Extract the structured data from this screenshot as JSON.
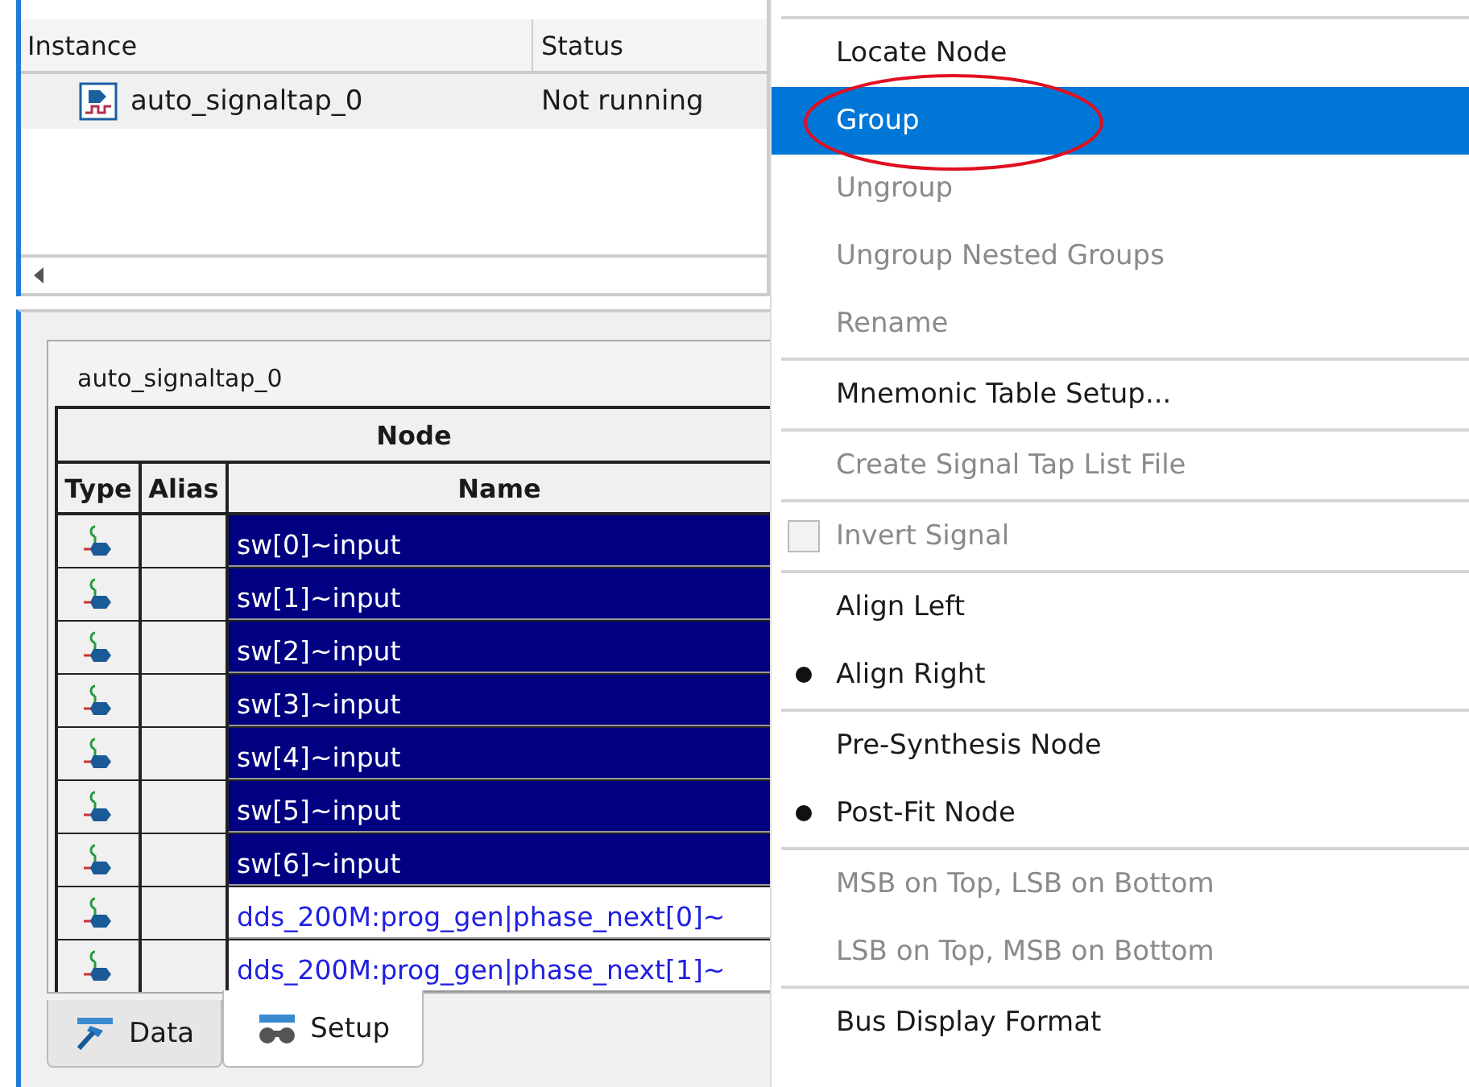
{
  "instances": {
    "columns": [
      "Instance",
      "Status"
    ],
    "rows": [
      {
        "name": "auto_signaltap_0",
        "status": "Not running"
      }
    ]
  },
  "setup": {
    "title": "auto_signaltap_0",
    "group_header": "Node",
    "columns": [
      "Type",
      "Alias",
      "Name"
    ],
    "rows": [
      {
        "name": "sw[0]~input",
        "selected": true
      },
      {
        "name": "sw[1]~input",
        "selected": true
      },
      {
        "name": "sw[2]~input",
        "selected": true
      },
      {
        "name": "sw[3]~input",
        "selected": true
      },
      {
        "name": "sw[4]~input",
        "selected": true
      },
      {
        "name": "sw[5]~input",
        "selected": true
      },
      {
        "name": "sw[6]~input",
        "selected": true
      },
      {
        "name": "dds_200M:prog_gen|phase_next[0]~",
        "selected": false
      },
      {
        "name": "dds_200M:prog_gen|phase_next[1]~",
        "selected": false
      }
    ]
  },
  "tabs": [
    {
      "label": "Data",
      "kind": "data",
      "selected": false
    },
    {
      "label": "Setup",
      "kind": "setup",
      "selected": true
    }
  ],
  "context_menu": [
    {
      "kind": "separator"
    },
    {
      "kind": "item",
      "label": "Locate Node",
      "disabled": false,
      "selected": false
    },
    {
      "kind": "item",
      "label": "Group",
      "disabled": false,
      "selected": true,
      "circled": true
    },
    {
      "kind": "item",
      "label": "Ungroup",
      "disabled": true,
      "selected": false
    },
    {
      "kind": "item",
      "label": "Ungroup Nested Groups",
      "disabled": true,
      "selected": false
    },
    {
      "kind": "item",
      "label": "Rename",
      "disabled": true,
      "selected": false
    },
    {
      "kind": "separator"
    },
    {
      "kind": "item",
      "label": "Mnemonic Table Setup...",
      "disabled": false,
      "selected": false
    },
    {
      "kind": "separator"
    },
    {
      "kind": "item",
      "label": "Create Signal Tap List File",
      "disabled": true,
      "selected": false
    },
    {
      "kind": "separator"
    },
    {
      "kind": "checkbox",
      "label": "Invert Signal",
      "disabled": true,
      "checked": false,
      "selected": false
    },
    {
      "kind": "separator"
    },
    {
      "kind": "radio",
      "label": "Align Left",
      "disabled": false,
      "checked": false,
      "selected": false
    },
    {
      "kind": "radio",
      "label": "Align Right",
      "disabled": false,
      "checked": true,
      "selected": false
    },
    {
      "kind": "separator"
    },
    {
      "kind": "radio",
      "label": "Pre-Synthesis Node",
      "disabled": false,
      "checked": false,
      "selected": false
    },
    {
      "kind": "radio",
      "label": "Post-Fit Node",
      "disabled": false,
      "checked": true,
      "selected": false
    },
    {
      "kind": "separator"
    },
    {
      "kind": "item",
      "label": "MSB on Top, LSB on Bottom",
      "disabled": true,
      "selected": false
    },
    {
      "kind": "item",
      "label": "LSB on Top, MSB on Bottom",
      "disabled": true,
      "selected": false
    },
    {
      "kind": "separator"
    },
    {
      "kind": "item",
      "label": "Bus Display Format",
      "disabled": false,
      "selected": false
    }
  ]
}
